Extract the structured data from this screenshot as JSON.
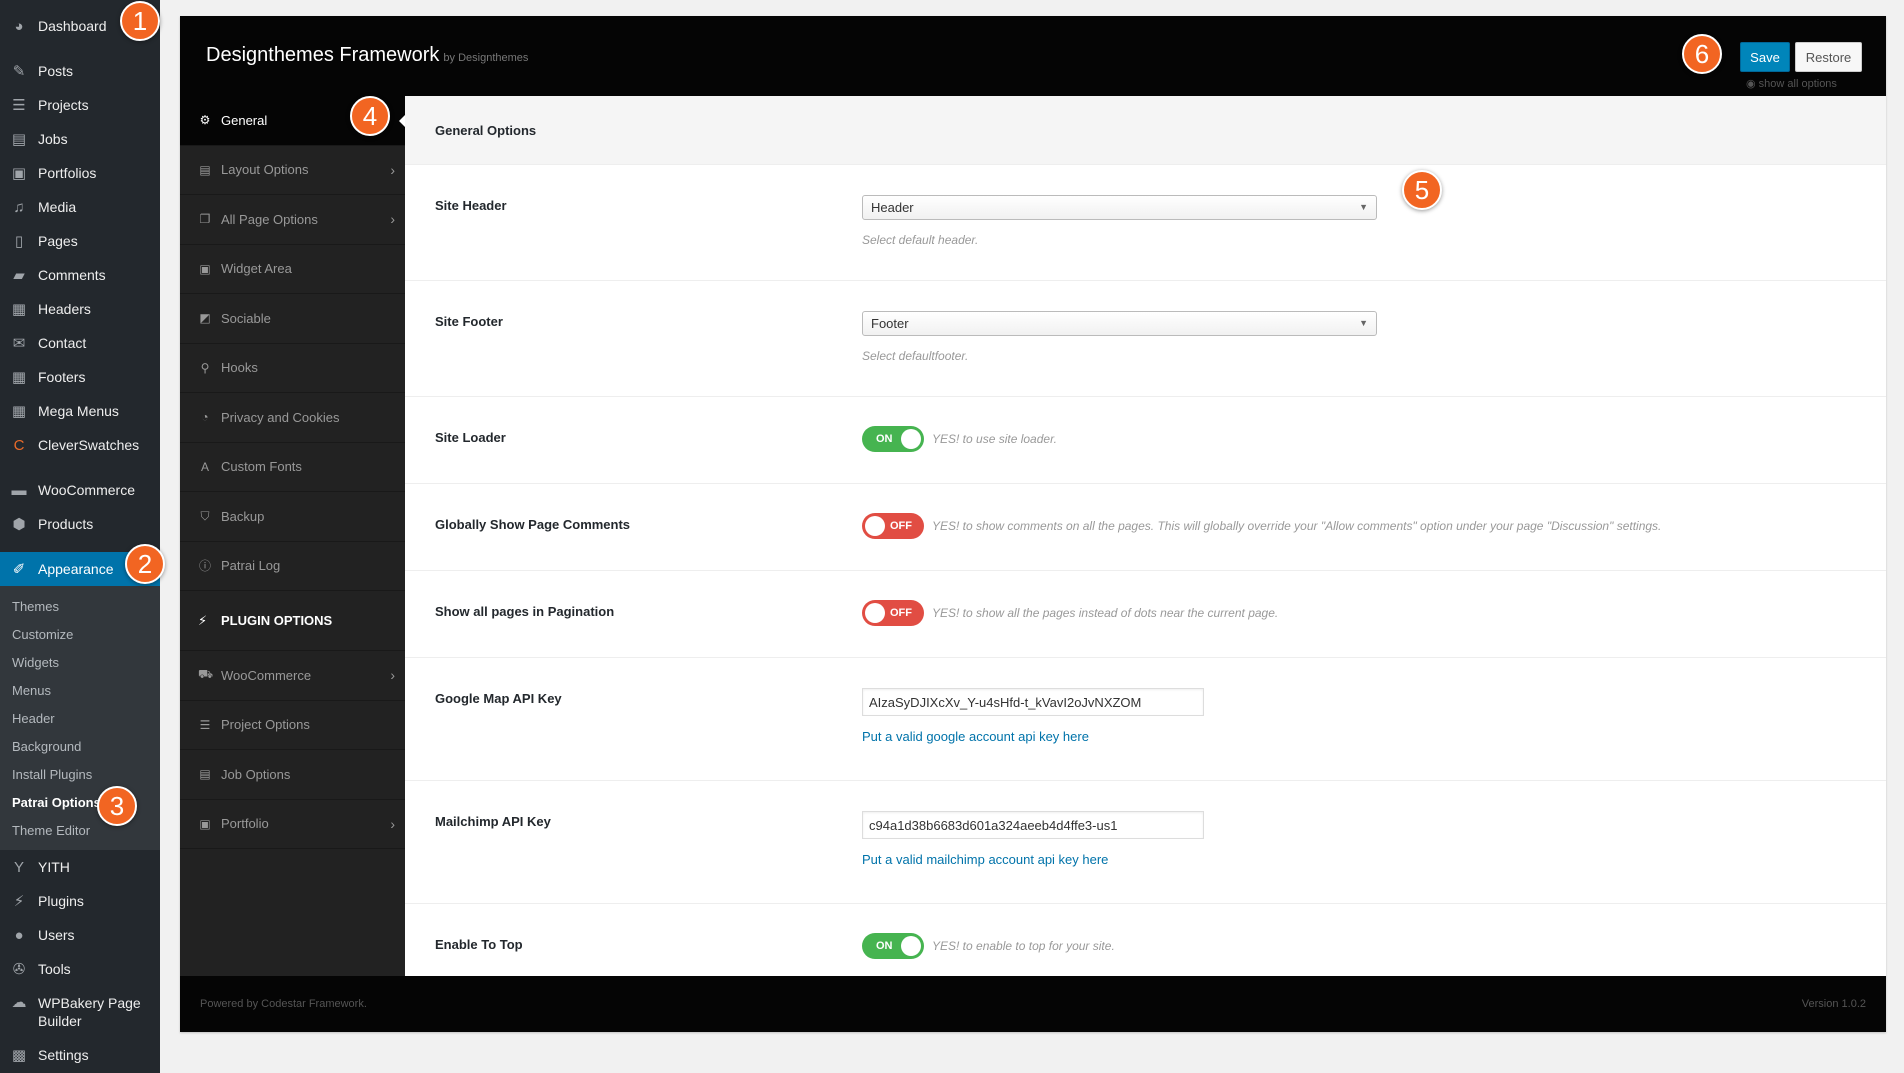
{
  "wp_menu": {
    "dashboard": "Dashboard",
    "posts": "Posts",
    "projects": "Projects",
    "jobs": "Jobs",
    "portfolios": "Portfolios",
    "media": "Media",
    "pages": "Pages",
    "comments": "Comments",
    "headers": "Headers",
    "contact": "Contact",
    "footers": "Footers",
    "mega_menus": "Mega Menus",
    "cleverswatches": "CleverSwatches",
    "woocommerce": "WooCommerce",
    "products": "Products",
    "appearance": "Appearance",
    "appearance_sub": [
      "Themes",
      "Customize",
      "Widgets",
      "Menus",
      "Header",
      "Background",
      "Install Plugins",
      "Patrai Options",
      "Theme Editor"
    ],
    "yith": "YITH",
    "plugins": "Plugins",
    "users": "Users",
    "tools": "Tools",
    "wpbakery": "WPBakery Page Builder",
    "settings": "Settings"
  },
  "markers": [
    "1",
    "2",
    "3",
    "4",
    "5",
    "6"
  ],
  "framework": {
    "title": "Designthemes Framework",
    "by": "by Designthemes",
    "save": "Save",
    "restore": "Restore",
    "show_all": "show all options"
  },
  "nav": {
    "general": "General",
    "layout_options": "Layout Options",
    "all_page_options": "All Page Options",
    "widget_area": "Widget Area",
    "sociable": "Sociable",
    "hooks": "Hooks",
    "privacy": "Privacy and Cookies",
    "custom_fonts": "Custom Fonts",
    "backup": "Backup",
    "patrai_log": "Patrai Log",
    "plugin_options": "PLUGIN OPTIONS",
    "woocommerce": "WooCommerce",
    "project_options": "Project Options",
    "job_options": "Job Options",
    "portfolio": "Portfolio"
  },
  "content": {
    "title": "General Options",
    "site_header": {
      "label": "Site Header",
      "value": "Header",
      "help": "Select default header."
    },
    "site_footer": {
      "label": "Site Footer",
      "value": "Footer",
      "help": "Select defaultfooter."
    },
    "site_loader": {
      "label": "Site Loader",
      "state": "ON",
      "help": "YES! to use site loader."
    },
    "page_comments": {
      "label": "Globally Show Page Comments",
      "state": "OFF",
      "help": "YES! to show comments on all the pages. This will globally override your \"Allow comments\" option under your page \"Discussion\" settings."
    },
    "pagination": {
      "label": "Show all pages in Pagination",
      "state": "OFF",
      "help": "YES! to show all the pages instead of dots near the current page."
    },
    "google_map": {
      "label": "Google Map API Key",
      "value": "AIzaSyDJIXcXv_Y-u4sHfd-t_kVavI2oJvNXZOM",
      "link": "Put a valid google account api key here"
    },
    "mailchimp": {
      "label": "Mailchimp API Key",
      "value": "c94a1d38b6683d601a324aeeb4d4ffe3-us1",
      "link": "Put a valid mailchimp account api key here"
    },
    "to_top": {
      "label": "Enable To Top",
      "state": "ON",
      "help": "YES! to enable to top for your site."
    }
  },
  "footer": {
    "left": "Powered by Codestar Framework.",
    "right": "Version 1.0.2"
  },
  "colors": {
    "accent": "#0073aa",
    "marker": "#f26522",
    "on": "#46b450",
    "off": "#e14d43"
  }
}
